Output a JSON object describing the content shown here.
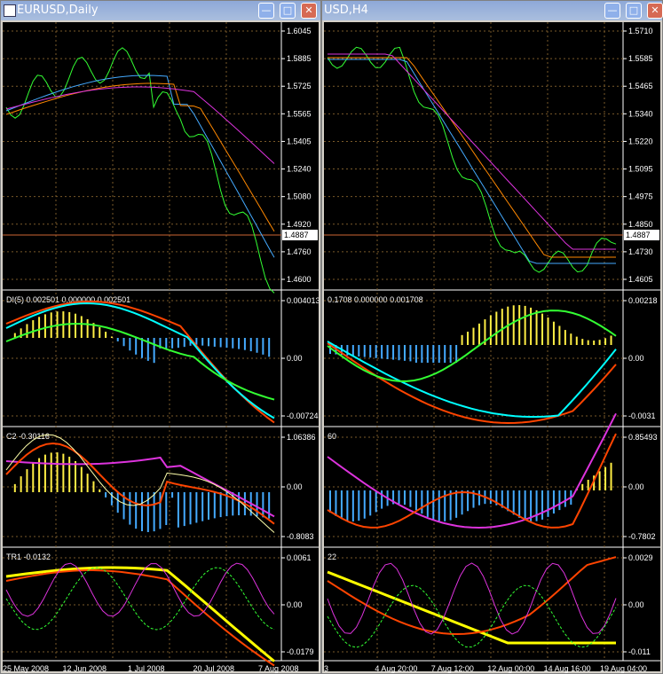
{
  "windows": [
    {
      "title": "EURUSD,Daily",
      "icons": {
        "minimize": "minimize-icon",
        "maximize": "maximize-icon",
        "close": "close-icon"
      },
      "panes": [
        {
          "label": "",
          "axis": [
            "1.6045",
            "1.5885",
            "1.5725",
            "1.5565",
            "1.5405",
            "1.5240",
            "1.5080",
            "1.4920",
            "1.4760",
            "1.4600"
          ],
          "price_box": "1.4887"
        },
        {
          "label": "DI(5) 0.002501 0.000000 0.002501",
          "axis": [
            "0.004013",
            "0.00",
            "-0.00724"
          ]
        },
        {
          "label": "C2 -0.30116",
          "axis": [
            "1.06386",
            "0.00",
            "-0.8083"
          ]
        },
        {
          "label": "TR1 -0.0132",
          "axis": [
            "0.0061",
            "0.00",
            "-0.0179"
          ]
        }
      ],
      "x_labels": [
        "25 May 2008",
        "12 Jun 2008",
        "1 Jul 2008",
        "20 Jul 2008",
        "7 Aug 2008"
      ]
    },
    {
      "title": "USD,H4",
      "icons": {
        "minimize": "minimize-icon",
        "maximize": "maximize-icon",
        "close": "close-icon"
      },
      "panes": [
        {
          "label": "",
          "axis": [
            "1.5710",
            "1.5585",
            "1.5465",
            "1.5340",
            "1.5220",
            "1.5095",
            "1.4975",
            "1.4850",
            "1.4730",
            "1.4605"
          ],
          "price_box": "1.4887"
        },
        {
          "label": "0.1708 0.000000 0.001708",
          "axis": [
            "0.00218",
            "0.00",
            "-0.0031"
          ]
        },
        {
          "label": "60",
          "axis": [
            "0.85493",
            "0.00",
            "-0.7802"
          ]
        },
        {
          "label": "22",
          "axis": [
            "0.0029",
            "0.00",
            "-0.011"
          ]
        }
      ],
      "x_labels": [
        "3",
        "4 Aug 20:00",
        "7 Aug 12:00",
        "12 Aug 00:00",
        "14 Aug 16:00",
        "19 Aug 04:00"
      ]
    }
  ],
  "colors": {
    "background": "#000000",
    "grid": "#7a5a2a",
    "axis_text": "#ffffff",
    "green": "#33ff33",
    "orange": "#ff8800",
    "blue": "#44aaff",
    "magenta": "#dd33dd",
    "red": "#ff4400",
    "yellow": "#ffff00",
    "cyan": "#00ffff",
    "hist_pos": "#ffee44",
    "hist_neg": "#44aaff",
    "price_line": "#cc6633",
    "title_text": "#ffffff"
  }
}
